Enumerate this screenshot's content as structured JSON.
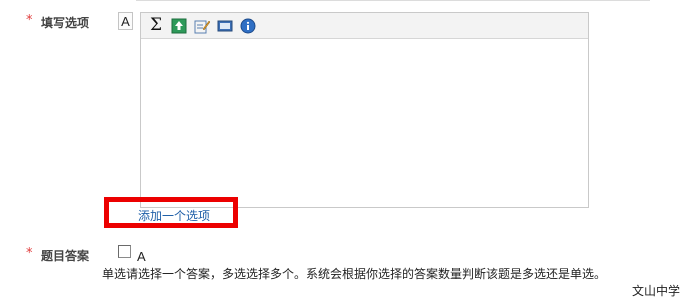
{
  "fill_options": {
    "required_mark": "*",
    "label": "填写选项",
    "option_letter": "A",
    "toolbar": {
      "sigma": "Σ",
      "icons": [
        "insert-image-icon",
        "edit-icon",
        "media-icon",
        "info-icon"
      ]
    },
    "add_option_link": "添加一个选项"
  },
  "answer": {
    "required_mark": "*",
    "label": "题目答案",
    "option_letter": "A",
    "checked": false,
    "hint": "单选请选择一个答案，多选选择多个。系统会根据你选择的答案数量判断该题是多选还是单选。"
  },
  "footer": {
    "school": "文山中学"
  },
  "colors": {
    "required": "#e03a3a",
    "link": "#1f5fa8",
    "highlight": "#ec0000"
  }
}
